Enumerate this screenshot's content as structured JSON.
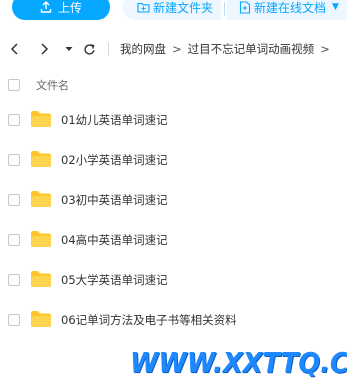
{
  "toolbar": {
    "upload_label": "上传",
    "new_folder_label": "新建文件夹",
    "new_online_doc_label": "新建在线文档"
  },
  "breadcrumb": {
    "items": [
      "我的网盘",
      "过目不忘记单词动画视频"
    ],
    "separator": ">"
  },
  "list": {
    "column_name": "文件名",
    "items": [
      {
        "name": "01幼儿英语单词速记",
        "type": "folder"
      },
      {
        "name": "02小学英语单词速记",
        "type": "folder"
      },
      {
        "name": "03初中英语单词速记",
        "type": "folder"
      },
      {
        "name": "04高中英语单词速记",
        "type": "folder"
      },
      {
        "name": "05大学英语单词速记",
        "type": "folder"
      },
      {
        "name": "06记单词方法及电子书等相关资料",
        "type": "folder"
      }
    ]
  },
  "watermark": {
    "text": "WWW.XXTTQ.COM"
  },
  "colors": {
    "accent": "#06a7ff",
    "accent_light": "#eef6ff",
    "folder": "#ffd24d",
    "watermark": "#1e88ff"
  },
  "icons": [
    "upload-icon",
    "new-folder-icon",
    "new-doc-icon",
    "back-icon",
    "forward-icon",
    "history-dropdown-icon",
    "refresh-icon",
    "folder-icon"
  ]
}
